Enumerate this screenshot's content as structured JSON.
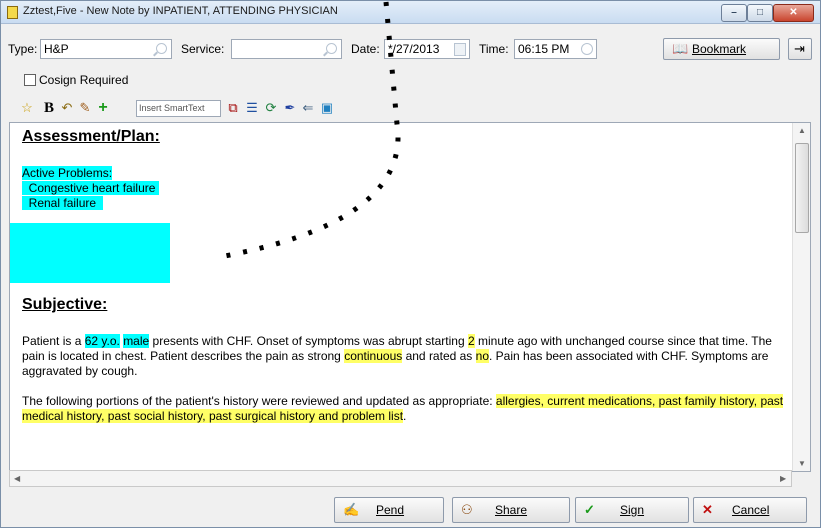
{
  "window": {
    "title": "Zztest,Five - New Note by INPATIENT, ATTENDING PHYSICIAN",
    "controls": {
      "minimize": "–",
      "maximize": "□",
      "close": "✕"
    }
  },
  "header": {
    "type_label": "Type:",
    "type_value": "H&P",
    "service_label": "Service:",
    "service_value": "",
    "date_label": "Date:",
    "date_value": "*/27/2013",
    "time_label": "Time:",
    "time_value": "06:15 PM",
    "bookmark_label": "Bookmark"
  },
  "cosign": {
    "label": "Cosign Required",
    "checked": false
  },
  "toolbar": {
    "smarttext_placeholder": "Insert SmartText",
    "icons": [
      "star-icon",
      "bold-icon",
      "undo-icon",
      "spellcheck-icon",
      "add-icon",
      "insert-smarttext-icon",
      "list-icon",
      "refresh-icon",
      "pen-icon",
      "import-icon",
      "image-icon"
    ]
  },
  "note": {
    "assessment_heading": "Assessment/Plan:",
    "active_problems_label": "Active Problems:",
    "problems": [
      "Congestive heart failure",
      "Renal failure"
    ],
    "subjective_heading": "Subjective:",
    "p1": {
      "a": "Patient is a ",
      "age": "62 y.o.",
      "b": " ",
      "sex": "male",
      "c": " presents with CHF. Onset of symptoms was abrupt starting ",
      "onset": "2",
      "d": " minute ago with unchanged course since that time. The pain is located in chest. Patient describes the pain as strong ",
      "quality": " continuous",
      "e": " and rated as ",
      "rating": "no",
      "f": ". Pain has been associated with CHF. Symptoms are aggravated by cough."
    },
    "p2": {
      "a": "The following portions of the patient's history were reviewed and updated as appropriate: ",
      "items": "allergies, current medications, past family history, past medical history, past social history, past surgical history and problem list",
      "b": "."
    }
  },
  "footer": {
    "pend_label": "Pend",
    "share_label": "Share",
    "sign_label": "Sign",
    "cancel_label": "Cancel"
  },
  "colors": {
    "cyan_highlight": "#00ffff",
    "yellow_highlight": "#ffff66"
  }
}
